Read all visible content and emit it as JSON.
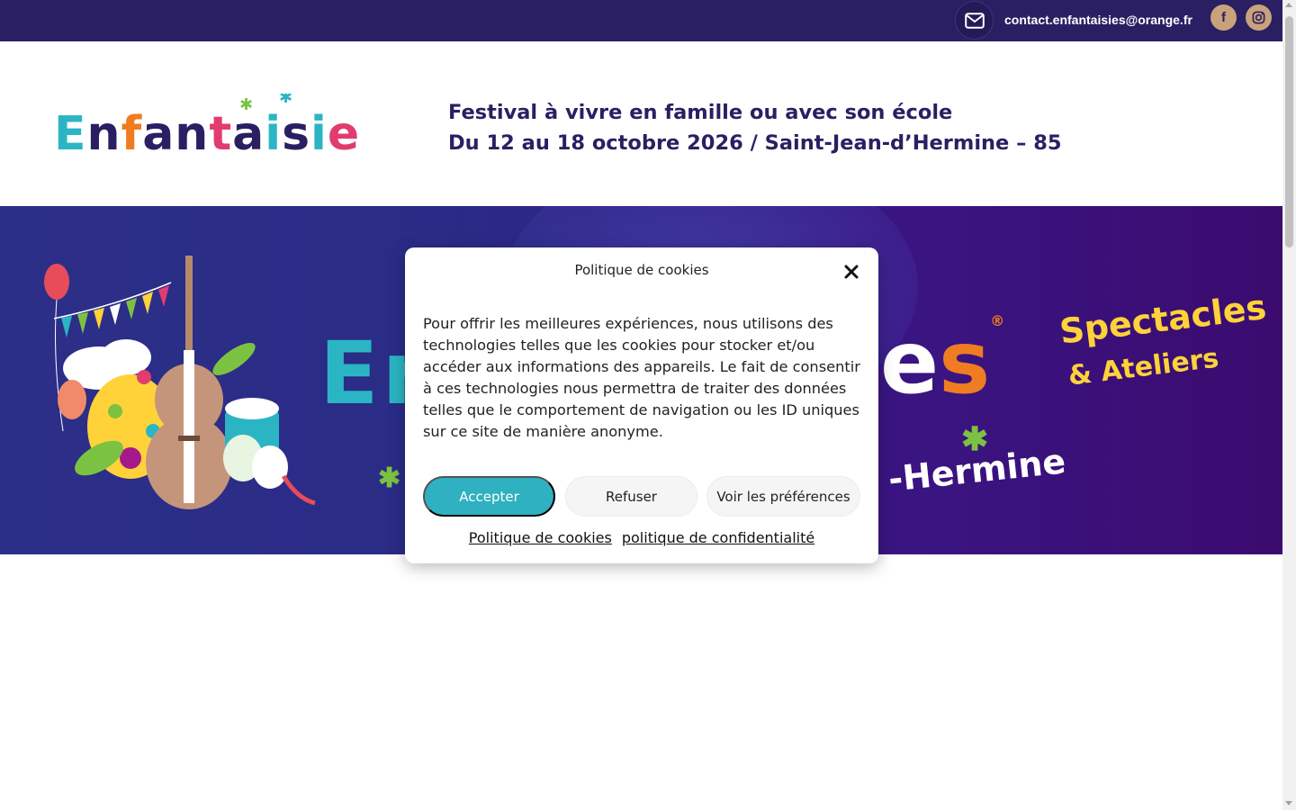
{
  "topbar": {
    "email": "contact.enfantaisies@orange.fr",
    "mail_icon": "envelope-icon",
    "social": [
      {
        "name": "facebook",
        "glyph": "f",
        "icon": "facebook-icon"
      },
      {
        "name": "instagram",
        "icon": "instagram-icon"
      }
    ]
  },
  "header": {
    "logo_text": "Enfantaisies",
    "tagline_line1": "Festival à vivre en famille ou avec son école",
    "tagline_line2": "Du 12 au 18 octobre 2026 / Saint-Jean-d’Hermine – 85"
  },
  "banner": {
    "title_start": "En",
    "title_end": "es",
    "registered": "®",
    "sub1": "Spectacles",
    "sub2": "& Ateliers",
    "place": "-Hermine"
  },
  "cookie_modal": {
    "title": "Politique de cookies",
    "body": "Pour offrir les meilleures expériences, nous utilisons des technologies telles que les cookies pour stocker et/ou accéder aux informations des appareils. Le fait de consentir à ces technologies nous permettra de traiter des données telles que le comportement de navigation ou les ID uniques sur ce site de manière anonyme.",
    "accept_label": "Accepter",
    "refuse_label": "Refuser",
    "prefs_label": "Voir les préférences",
    "link_cookies": "Politique de cookies",
    "link_privacy": "politique de confidentialité"
  },
  "colors": {
    "topbar": "#2b1f63",
    "brand_navy": "#2b1f63",
    "accent_teal": "#2fb1c1",
    "social_bg": "#c9a27c",
    "banner_start": "#2c2f88",
    "banner_end": "#3b0b6f"
  }
}
